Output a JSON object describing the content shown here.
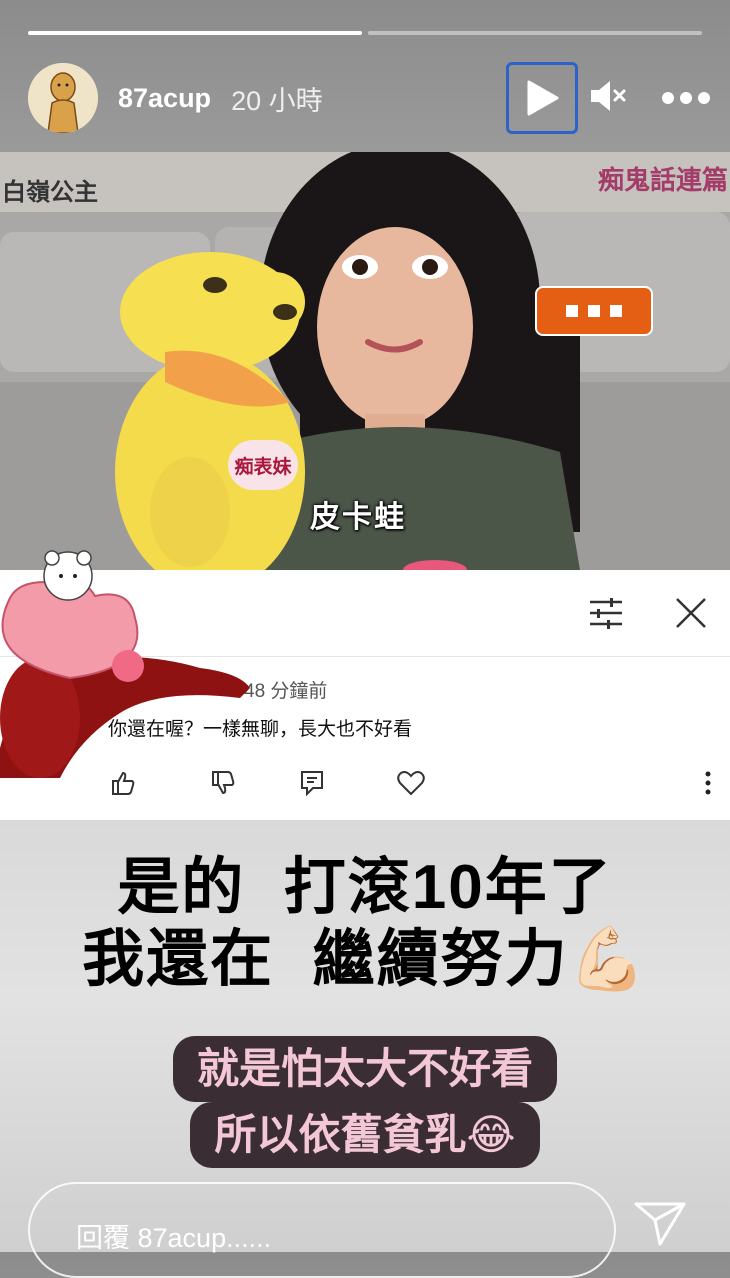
{
  "story": {
    "progress": [
      1.0,
      0.0
    ],
    "username": "87acup",
    "timestamp": "20 小時"
  },
  "header": {
    "play_icon": "play-icon",
    "mute_icon": "mute-icon",
    "more_icon": "more-dots-icon"
  },
  "video": {
    "badge_top_right": "痴鬼話連篇",
    "badge_top_left": "白嶺公主",
    "name_tag": "痴表妹",
    "caption": "皮卡蛙"
  },
  "comment": {
    "time_ago": "48 分鐘前",
    "text": "你還在喔？一樣無聊，長大也不好看"
  },
  "captions": {
    "line1": "是的  打滾10年了",
    "line2": "我還在  繼續努力💪🏻",
    "pill_line1": "就是怕太大不好看",
    "pill_line2": "所以依舊貧乳😂"
  },
  "reply": {
    "placeholder": "回覆 87acup......"
  },
  "colors": {
    "accent_border": "#2f62c8",
    "bubble": "#e45f14",
    "pill_bg": "#3a2d33",
    "pill_text": "#f3c7d6"
  }
}
